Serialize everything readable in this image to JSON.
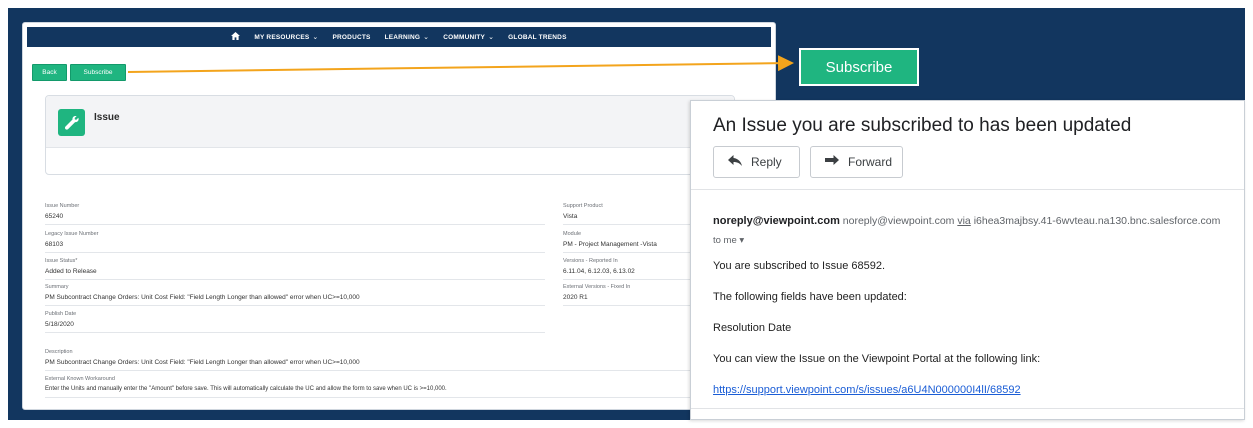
{
  "nav": {
    "items": [
      {
        "label": "MY RESOURCES",
        "dropdown": true
      },
      {
        "label": "PRODUCTS",
        "dropdown": false
      },
      {
        "label": "LEARNING",
        "dropdown": true
      },
      {
        "label": "COMMUNITY",
        "dropdown": true
      },
      {
        "label": "GLOBAL TRENDS",
        "dropdown": false
      }
    ]
  },
  "portal": {
    "back_label": "Back",
    "subscribe_label": "Subscribe",
    "record_title": "Issue",
    "fields": {
      "issue_number": {
        "label": "Issue Number",
        "value": "65240"
      },
      "legacy_issue_number": {
        "label": "Legacy Issue Number",
        "value": "68103"
      },
      "issue_status": {
        "label": "Issue Status*",
        "value": "Added to Release"
      },
      "summary": {
        "label": "Summary",
        "value": "PM Subcontract Change Orders: Unit Cost Field: \"Field Length Longer than allowed\" error when UC>=10,000"
      },
      "publish_date": {
        "label": "Publish Date",
        "value": "5/18/2020"
      },
      "description": {
        "label": "Description",
        "value": "PM Subcontract Change Orders: Unit Cost Field: \"Field Length Longer than allowed\" error when UC>=10,000"
      },
      "workaround": {
        "label": "External Known Workaround",
        "value": "Enter the Units and manually enter the \"Amount\" before save. This will automatically calculate the UC and allow the form to save when UC is >=10,000."
      },
      "support_product": {
        "label": "Support Product",
        "value": "Vista"
      },
      "module": {
        "label": "Module",
        "value": "PM - Project Management -Vista"
      },
      "versions_reported": {
        "label": "Versions - Reported In",
        "value": "6.11.04, 6.12.03, 6.13.02"
      },
      "external_versions_fixed": {
        "label": "External Versions - Fixed In",
        "value": "2020 R1"
      }
    }
  },
  "callout": {
    "subscribe_label": "Subscribe"
  },
  "email": {
    "subject": "An Issue you are subscribed to has been updated",
    "reply_label": "Reply",
    "forward_label": "Forward",
    "sender_name": "noreply@viewpoint.com",
    "sender_email": "noreply@viewpoint.com",
    "via_label": "via",
    "via_domain": "i6hea3majbsy.41-6wvteau.na130.bnc.salesforce.com",
    "to_label": "to me",
    "lines": [
      "You are subscribed to Issue 68592.",
      "The following fields have been updated:",
      "Resolution Date",
      "You can view the Issue on the Viewpoint Portal at the following link:"
    ],
    "link": "https://support.viewpoint.com/s/issues/a6U4N000000I4lI/68592"
  },
  "colors": {
    "navy": "#12365f",
    "brand_green": "#1fb580",
    "callout_arrow": "#f3a41c",
    "link_blue": "#1a5dd6"
  }
}
